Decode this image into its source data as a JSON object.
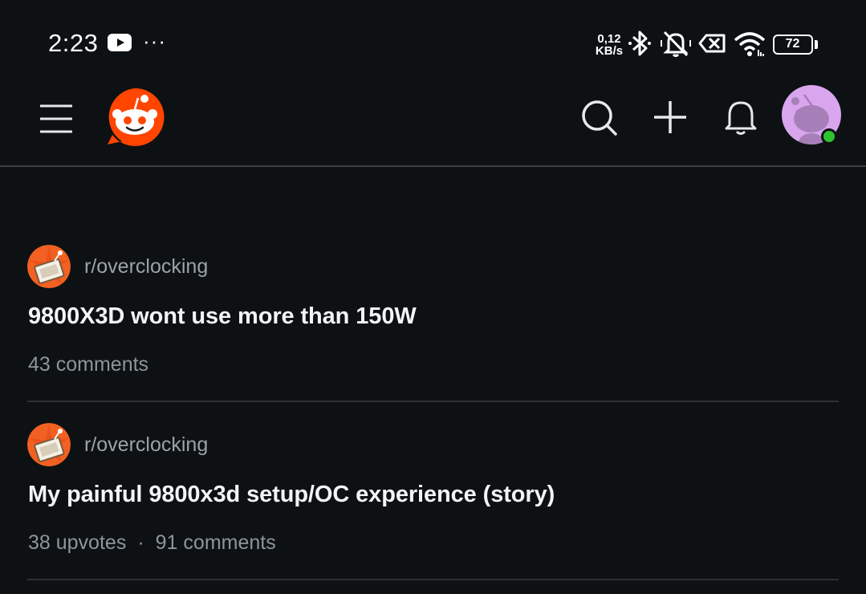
{
  "status_bar": {
    "time": "2:23",
    "more": "···",
    "net_speed_value": "0,12",
    "net_speed_unit": "KB/s",
    "battery": "72"
  },
  "header": {
    "icons": [
      "menu-icon",
      "reddit-logo",
      "search-icon",
      "plus-icon",
      "bell-icon",
      "avatar"
    ]
  },
  "feed": {
    "posts": [
      {
        "subreddit": "r/overclocking",
        "title": "9800X3D wont use more than 150W",
        "upvotes": "",
        "comments": "43 comments"
      },
      {
        "subreddit": "r/overclocking",
        "title": "My painful 9800x3d setup/OC experience (story)",
        "upvotes": "38 upvotes",
        "separator": "·",
        "comments": "91 comments"
      }
    ]
  },
  "colors": {
    "background": "#0e1113",
    "brand": "#ff4500",
    "online": "#2fc22f",
    "avatar_bg": "#d9a6ee"
  }
}
